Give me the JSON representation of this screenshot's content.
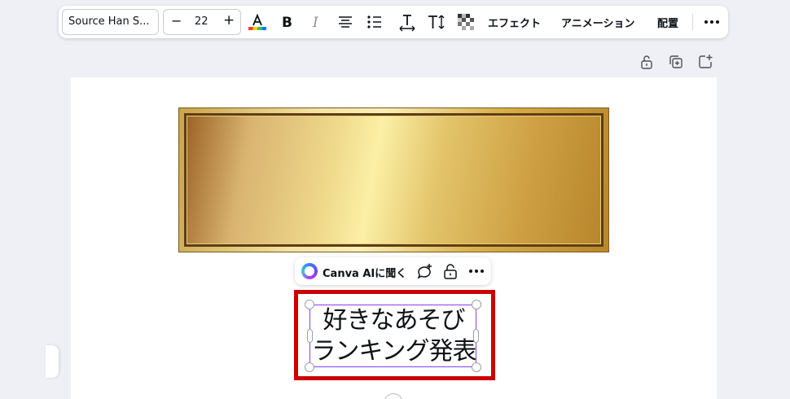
{
  "toolbar": {
    "font_name": "Source Han S...",
    "font_size": "22",
    "minus_label": "−",
    "plus_label": "+",
    "effects_label": "エフェクト",
    "animate_label": "アニメーション",
    "position_label": "配置",
    "icons": [
      "text-color-icon",
      "bold-icon",
      "italic-icon",
      "align-center-icon",
      "list-icon",
      "letter-spacing-icon",
      "text-direction-icon",
      "transparency-icon",
      "more-icon"
    ]
  },
  "page_actions": [
    "lock-icon",
    "duplicate-page-icon",
    "add-page-icon"
  ],
  "context_menu": {
    "ai_label": "Canva AIに聞く",
    "icons": [
      "comment-add-icon",
      "lock-icon",
      "more-icon"
    ]
  },
  "text_element": {
    "line1": "好きなあそび",
    "line2": "ランキング発表"
  },
  "colors": {
    "selection": "#8b3dff",
    "highlight": "#cc0000",
    "gold_dark": "#5e3d12",
    "gold_light": "#fbf0a6"
  }
}
